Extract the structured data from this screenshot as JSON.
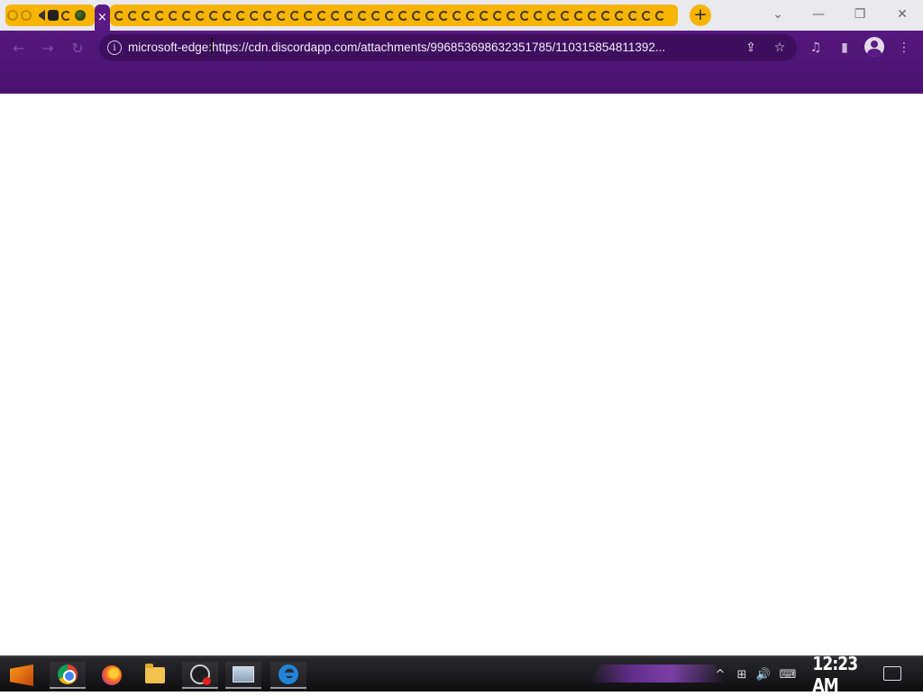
{
  "browser": {
    "tabstrip": {
      "left_favicons": [
        "google-g-icon",
        "google-g-icon",
        "speaker-icon",
        "skull-icon",
        "edge-icon",
        "ball-icon"
      ],
      "active_tab_close": "×",
      "pinned_tab_count_label": "",
      "new_tab_label": "+"
    },
    "window_controls": {
      "tab_search": "⌄",
      "minimize": "—",
      "restore": "❐",
      "close": "✕"
    },
    "toolbar": {
      "back": "←",
      "forward": "→",
      "reload": "↻",
      "site_info": "i",
      "url": "microsoft-edge:https://cdn.discordapp.com/attachments/996853698632351785/110315854811392...",
      "share": "⇪",
      "bookmark": "☆",
      "media": "♫",
      "side_panel": "▮",
      "menu": "⋮"
    }
  },
  "taskbar": {
    "apps": [
      "start-icon",
      "chrome-icon",
      "firefox-icon",
      "file-explorer-icon",
      "obs-icon",
      "photos-icon",
      "edge-icon"
    ],
    "tray": {
      "chevron": "^",
      "network": "⊞",
      "volume": "🔊",
      "keyboard": "⌨"
    },
    "clock": "12:23 AM"
  },
  "colors": {
    "browser_theme": "#5a1a86",
    "tab_accent": "#f7b400",
    "taskbar": "#0e0e10"
  }
}
